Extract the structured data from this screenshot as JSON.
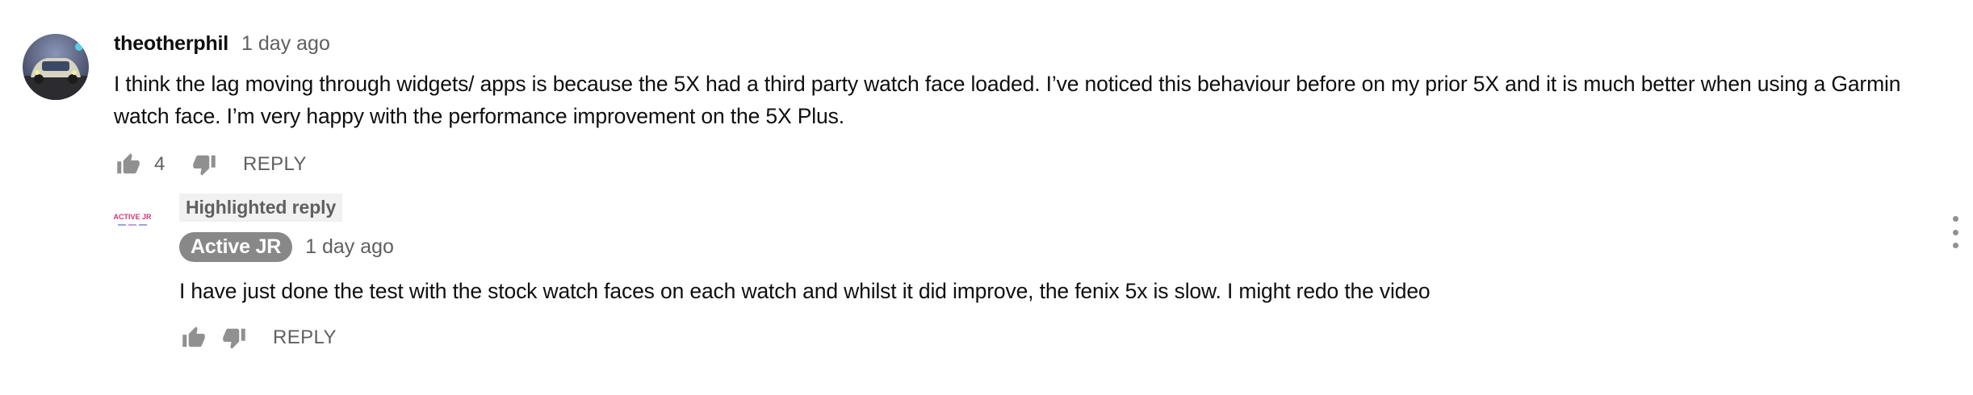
{
  "comment": {
    "author": "theotherphil",
    "timestamp": "1 day ago",
    "text": "I think the lag moving through widgets/ apps is because the 5X had a third party watch face loaded. I’ve noticed this behaviour before on my prior 5X and it is much better when using a Garmin watch face. I’m very happy with the performance improvement on the 5X Plus.",
    "like_count": "4",
    "reply_label": "REPLY",
    "avatar_icon": "user-avatar-photo"
  },
  "reply": {
    "badge": "Highlighted reply",
    "author": "Active JR",
    "timestamp": "1 day ago",
    "text": "I have just done the test with the stock watch faces on each watch and whilst it did improve, the fenix 5x is slow. I might redo the video",
    "reply_label": "REPLY",
    "avatar_logo_text": "ACTIVE JR"
  },
  "icons": {
    "like": "thumbs-up-icon",
    "dislike": "thumbs-down-icon",
    "more": "more-vert-icon"
  },
  "colors": {
    "text_primary": "#0f0f0f",
    "text_secondary": "#606060",
    "icon": "#909090",
    "author_chip_bg": "#888888",
    "badge_bg": "#f1f1f1"
  }
}
